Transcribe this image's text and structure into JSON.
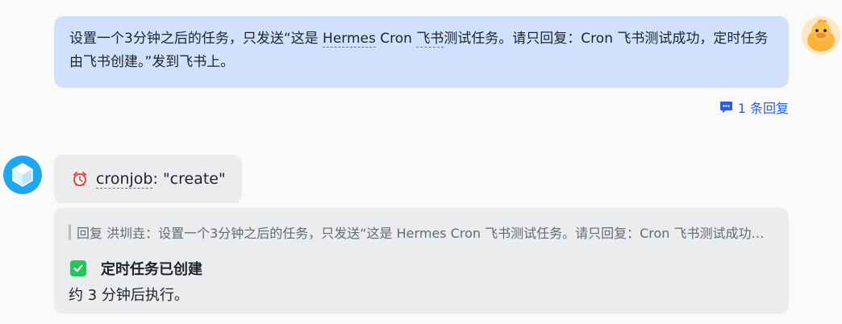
{
  "user_message": {
    "text_before": "设置一个3分钟之后的任务，只发送“这是 ",
    "link_1": "Hermes",
    "text_middle": " Cron ",
    "link_2": "飞书",
    "text_after": "测试任务。请只回复：Cron 飞书测试成功，定时任务由飞书创建。”发到飞书上。"
  },
  "thread": {
    "reply_count_label": "1 条回复",
    "icon": "comment-icon"
  },
  "tool_call": {
    "icon": "alarm-clock-icon",
    "name": "cronjob",
    "separator": ": ",
    "args": "\"create\""
  },
  "bot_reply": {
    "quote_text": "回复 洪圳垚：设置一个3分钟之后的任务，只发送“这是 Hermes Cron 飞书测试任务。请只回复：Cron 飞书测试成功，定时任务由飞书创建。”发到飞书上。",
    "status_icon": "checkbox-checked-icon",
    "status_title": "定时任务已创建",
    "detail": "约 3 分钟后执行。"
  },
  "avatars": {
    "user": "duck-avatar",
    "bot": "cube-avatar"
  },
  "colors": {
    "user_bubble": "#cfe1fd",
    "bot_bubble": "#ebecee",
    "link_blue": "#2a5ee8",
    "check_green": "#22c55e",
    "bot_avatar": "#1ea7f0"
  }
}
